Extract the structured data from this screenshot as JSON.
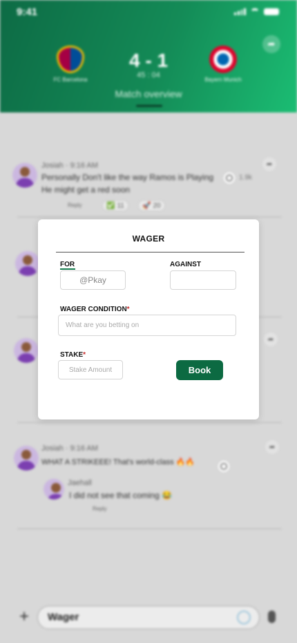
{
  "status_bar": {
    "time": "9:41"
  },
  "match": {
    "home_team": "FC Barcelona",
    "away_team": "Bayern Munich",
    "score": "4 - 1",
    "clock": "45 : 04",
    "tab_label": "Match overview"
  },
  "feed": {
    "posts": [
      {
        "username": "Josiah",
        "time": "9:16 AM",
        "text_line1": "Personally Don't like the way Ramos is Playing",
        "text_line2": "He might get a red soon",
        "reply_label": "Reply",
        "reaction1_count": "11",
        "reaction2_count": "20",
        "side_count": "1.9k"
      },
      {
        "username": "Josiah",
        "time": "9:16 AM",
        "text_line1": "WHAT A STRIKEEE! That's world-class 🔥🔥",
        "reply_username": "Jaehall",
        "reply_text": "I did not see that coming 😂",
        "reply_label": "Reply"
      }
    ]
  },
  "composer": {
    "value": "Wager"
  },
  "wager_modal": {
    "title": "WAGER",
    "for_label": "FOR",
    "for_value": "@Pkay",
    "against_label": "AGAINST",
    "against_value": "",
    "condition_label": "WAGER CONDITION",
    "condition_placeholder": "What are you betting on",
    "stake_label": "STAKE",
    "stake_placeholder": "Stake Amount",
    "required_marker": "*",
    "book_label": "Book"
  },
  "colors": {
    "brand_green": "#0c6a42",
    "required_red": "#c62828"
  }
}
